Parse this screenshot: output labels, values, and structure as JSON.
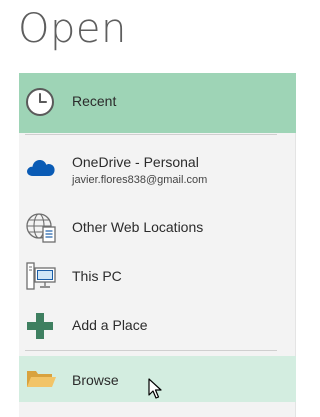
{
  "page": {
    "title": "Open"
  },
  "locations": {
    "recent": {
      "label": "Recent",
      "icon": "clock-icon"
    },
    "onedrive": {
      "label": "OneDrive - Personal",
      "account": "javier.flores838@gmail.com",
      "icon": "cloud-icon"
    },
    "web_locations": {
      "label": "Other Web Locations",
      "icon": "globe-document-icon"
    },
    "this_pc": {
      "label": "This PC",
      "icon": "computer-icon"
    },
    "add_place": {
      "label": "Add a Place",
      "icon": "plus-icon"
    },
    "browse": {
      "label": "Browse",
      "icon": "folder-icon"
    }
  },
  "colors": {
    "selected_bg": "#9ed4b6",
    "hover_bg": "#d3ede0",
    "panel_bg": "#f3f3f3",
    "onedrive_blue": "#0a5bb5",
    "plus_green": "#3e7f60",
    "folder_gold": "#e8b54f"
  }
}
